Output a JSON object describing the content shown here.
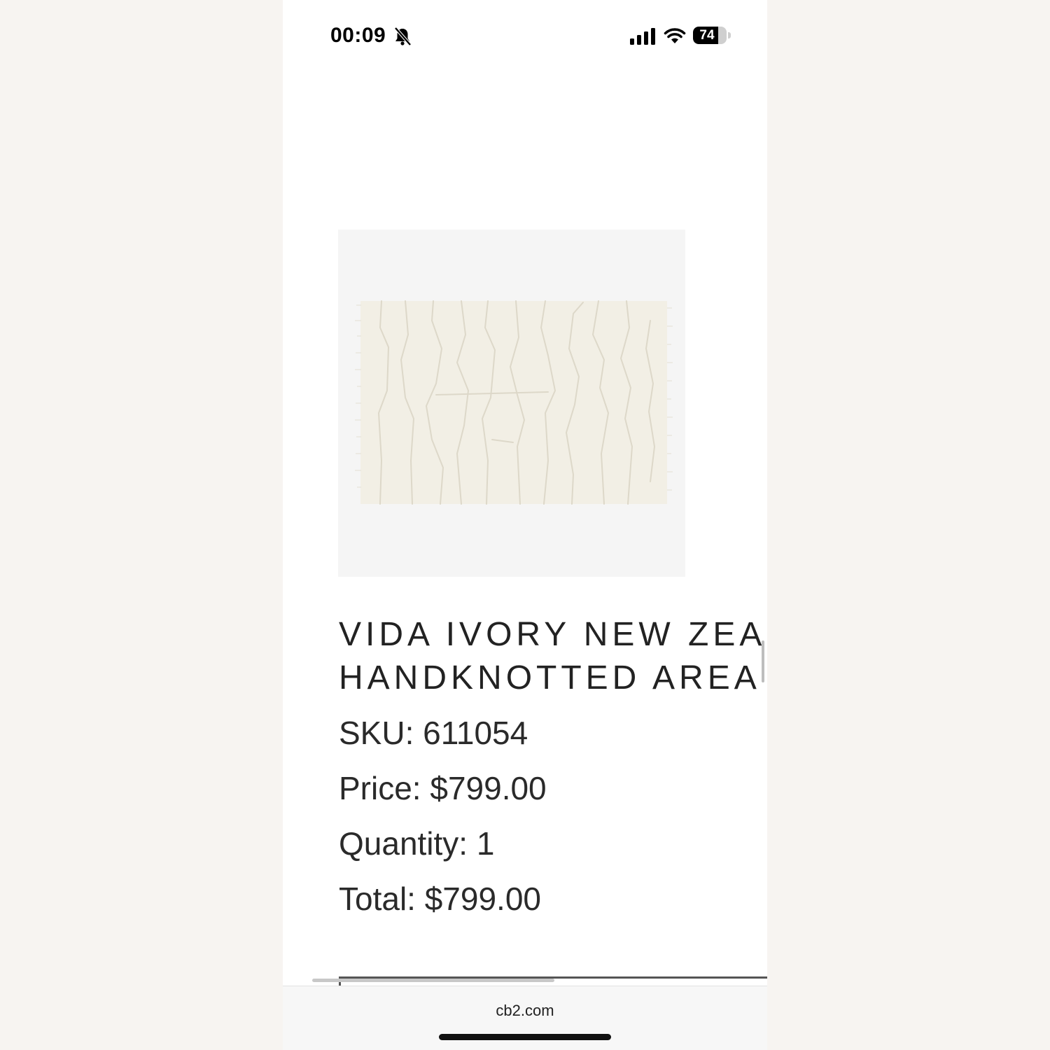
{
  "status_bar": {
    "time": "00:09",
    "battery_level": 74,
    "battery_text": "74",
    "icons": [
      "bell-slash-icon",
      "cellular-signal-icon",
      "wifi-icon",
      "battery-icon"
    ]
  },
  "product": {
    "image_alt": "rug-image",
    "title_line1": "VIDA IVORY NEW ZEA",
    "title_line2": "HANDKNOTTED AREA",
    "sku": "SKU: 611054",
    "price": "Price: $799.00",
    "quantity": "Quantity: 1",
    "total": "Total: $799.00"
  },
  "browser": {
    "url": "cb2.com"
  },
  "colors": {
    "page_background": "#f7f4f1",
    "screen_background": "#ffffff",
    "text": "#222222",
    "rug": "#f2efe6"
  }
}
